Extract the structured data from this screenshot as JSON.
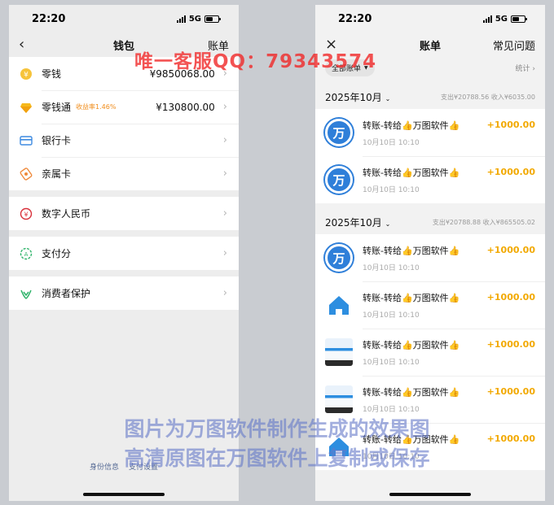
{
  "left_phone": {
    "status": {
      "time": "22:20",
      "network": "5G"
    },
    "nav": {
      "back_icon": "‹",
      "title": "钱包",
      "right": "账单"
    },
    "group1": [
      {
        "icon": "coin-icon",
        "label": "零钱",
        "value": "¥9850068.00"
      },
      {
        "icon": "diamond-icon",
        "label": "零钱通",
        "badge": "收益率1.46%",
        "value": "¥130800.00"
      },
      {
        "icon": "bank-card-icon",
        "label": "银行卡"
      },
      {
        "icon": "family-card-icon",
        "label": "亲属卡"
      }
    ],
    "group2": [
      {
        "icon": "digital-rmb-icon",
        "label": "数字人民币"
      }
    ],
    "group3": [
      {
        "icon": "pay-score-icon",
        "label": "支付分"
      }
    ],
    "group4": [
      {
        "icon": "shield-icon",
        "label": "消费者保护"
      }
    ],
    "footer": {
      "identity": "身份信息",
      "settings": "支付设置"
    }
  },
  "right_phone": {
    "status": {
      "time": "22:20",
      "network": "5G"
    },
    "nav": {
      "close_icon": "×",
      "title": "账单",
      "right": "常见问题"
    },
    "filter": {
      "label": "全部账单",
      "stats": "统计 ›"
    },
    "months": [
      {
        "label": "2025年10月",
        "summary": "支出¥20788.56  收入¥6035.00",
        "items": [
          {
            "avatar": "wan",
            "name": "转账-转给👍万图软件👍",
            "date": "10月10日 10:10",
            "amount": "+1000.00"
          },
          {
            "avatar": "wan",
            "name": "转账-转给👍万图软件👍",
            "date": "10月10日 10:10",
            "amount": "+1000.00"
          }
        ]
      },
      {
        "label": "2025年10月",
        "summary": "支出¥20788.88  收入¥865505.02",
        "items": [
          {
            "avatar": "wan",
            "name": "转账-转给👍万图软件👍",
            "date": "10月10日 10:10",
            "amount": "+1000.00"
          },
          {
            "avatar": "home",
            "name": "转账-转给👍万图软件👍",
            "date": "10月10日 10:10",
            "amount": "+1000.00"
          },
          {
            "avatar": "img",
            "name": "转账-转给👍万图软件👍",
            "date": "10月10日 10:10",
            "amount": "+1000.00"
          },
          {
            "avatar": "img",
            "name": "转账-转给👍万图软件👍",
            "date": "10月10日 10:10",
            "amount": "+1000.00"
          },
          {
            "avatar": "home",
            "name": "转账-转给👍万图软件👍",
            "date": "10月10日 10:10",
            "amount": "+1000.00"
          }
        ]
      }
    ]
  },
  "watermarks": {
    "top": "唯一客服QQ：79343574",
    "bottom_line1": "图片为万图软件制作生成的效果图",
    "bottom_line2": "高清原图在万图软件上复制或保存"
  },
  "colors": {
    "accent_gold": "#f2a900",
    "link_blue": "#576b95",
    "avatar_blue": "#2f7fd9"
  }
}
